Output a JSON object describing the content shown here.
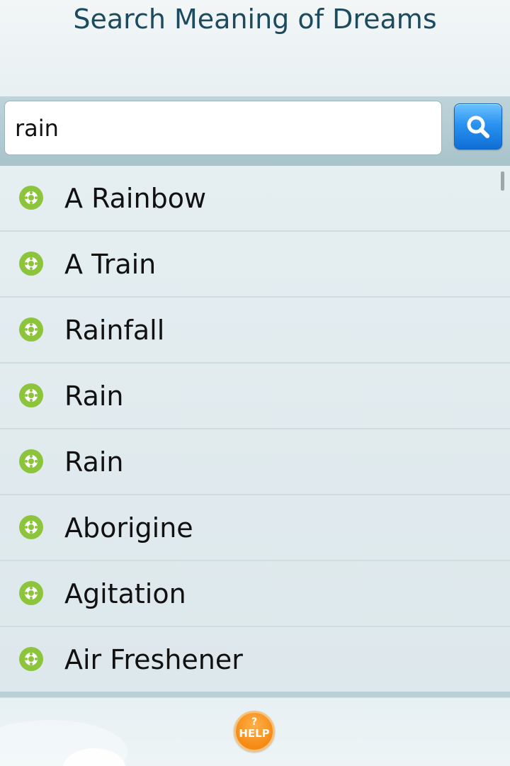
{
  "header": {
    "title": "Search Meaning of Dreams"
  },
  "search": {
    "value": "rain",
    "button_icon": "search-icon",
    "accent": "#2a92f0"
  },
  "results": {
    "icon": "flower-bullet-icon",
    "icon_color": "#8cc43c",
    "items": [
      {
        "label": "A Rainbow"
      },
      {
        "label": "A Train"
      },
      {
        "label": "Rainfall"
      },
      {
        "label": "Rain"
      },
      {
        "label": "Rain"
      },
      {
        "label": "Aborigine"
      },
      {
        "label": "Agitation"
      },
      {
        "label": "Air Freshener"
      }
    ]
  },
  "footer": {
    "help_mark": "?",
    "help_label": "HELP",
    "help_color": "#f48a14"
  }
}
